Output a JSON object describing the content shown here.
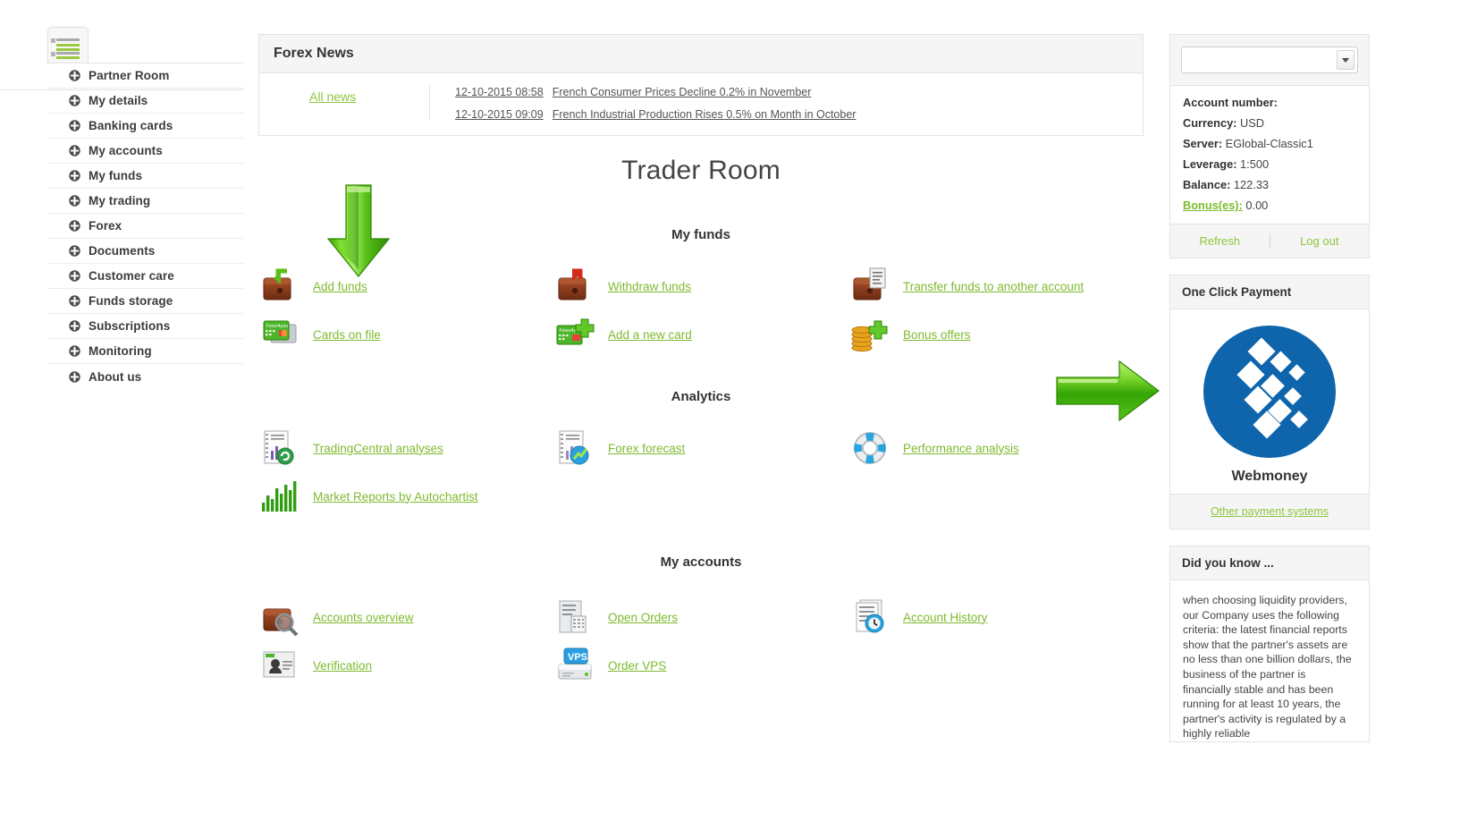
{
  "sidebar": {
    "toggle_icon": "list-menu-icon",
    "items": [
      {
        "label": "Partner Room",
        "icon": "plus-circle-icon"
      },
      {
        "label": "My details",
        "icon": "plus-circle-icon"
      },
      {
        "label": "Banking cards",
        "icon": "plus-circle-icon"
      },
      {
        "label": "My accounts",
        "icon": "plus-circle-icon"
      },
      {
        "label": "My funds",
        "icon": "plus-circle-icon"
      },
      {
        "label": "My trading",
        "icon": "plus-circle-icon"
      },
      {
        "label": "Forex",
        "icon": "plus-circle-icon"
      },
      {
        "label": "Documents",
        "icon": "plus-circle-icon"
      },
      {
        "label": "Customer care",
        "icon": "plus-circle-icon"
      },
      {
        "label": "Funds storage",
        "icon": "plus-circle-icon"
      },
      {
        "label": "Subscriptions",
        "icon": "plus-circle-icon"
      },
      {
        "label": "Monitoring",
        "icon": "plus-circle-icon"
      },
      {
        "label": "About us",
        "icon": "plus-circle-icon"
      }
    ]
  },
  "news": {
    "title": "Forex News",
    "all_news_label": "All news",
    "items": [
      {
        "date": "12-10-2015 08:58",
        "headline": "French Consumer Prices Decline 0.2% in November"
      },
      {
        "date": "12-10-2015 09:09",
        "headline": "French Industrial Production Rises 0.5% on Month in October"
      }
    ]
  },
  "main": {
    "page_title": "Trader Room",
    "sections": [
      {
        "title": "My funds",
        "rows": [
          [
            {
              "label": "Add funds",
              "icon": "wallet-in-icon"
            },
            {
              "label": "Withdraw funds",
              "icon": "wallet-out-icon"
            },
            {
              "label": "Transfer funds to another account",
              "icon": "wallet-transfer-icon"
            }
          ],
          [
            {
              "label": "Cards on file",
              "icon": "credit-cards-icon"
            },
            {
              "label": "Add a new card",
              "icon": "card-plus-icon"
            },
            {
              "label": "Bonus offers",
              "icon": "coins-plus-icon"
            }
          ]
        ]
      },
      {
        "title": "Analytics",
        "rows": [
          [
            {
              "label": "TradingCentral analyses",
              "icon": "report-refresh-icon"
            },
            {
              "label": "Forex forecast",
              "icon": "report-chart-icon"
            },
            {
              "label": "Performance analysis",
              "icon": "lifebuoy-icon"
            }
          ],
          [
            {
              "label": "Market Reports by Autochartist",
              "icon": "bar-chart-icon"
            },
            {
              "label": "",
              "icon": ""
            },
            {
              "label": "",
              "icon": ""
            }
          ]
        ]
      },
      {
        "title": "My accounts",
        "rows": [
          [
            {
              "label": "Accounts overview",
              "icon": "wallet-magnifier-icon"
            },
            {
              "label": "Open Orders",
              "icon": "server-list-icon"
            },
            {
              "label": "Account History",
              "icon": "documents-clock-icon"
            }
          ],
          [
            {
              "label": "Verification",
              "icon": "id-card-icon"
            },
            {
              "label": "Order VPS",
              "icon": "vps-server-icon"
            },
            {
              "label": "",
              "icon": ""
            }
          ]
        ]
      }
    ],
    "decor": {
      "down_arrow_icon": "green-down-arrow-icon",
      "right_arrow_icon": "green-right-arrow-icon"
    }
  },
  "account_panel": {
    "select_value": "",
    "select_caret_icon": "chevron-down-icon",
    "fields": [
      {
        "key": "Account number:",
        "value": ""
      },
      {
        "key": "Currency:",
        "value": "USD"
      },
      {
        "key": "Server:",
        "value": "EGlobal-Classic1"
      },
      {
        "key": "Leverage:",
        "value": "1:500"
      },
      {
        "key": "Balance:",
        "value": "122.33"
      },
      {
        "key": "Bonus(es):",
        "value": "0.00",
        "link": true
      }
    ],
    "refresh_label": "Refresh",
    "logout_label": "Log out"
  },
  "one_click_payment": {
    "title": "One Click Payment",
    "provider_name": "Webmoney",
    "provider_logo_icon": "webmoney-logo-icon",
    "other_systems_label": "Other payment systems"
  },
  "did_you_know": {
    "title": "Did you know ...",
    "text": "when choosing liquidity providers, our Company uses the following criteria: the latest financial reports show that the partner's assets are no less than one billion dollars, the business of the partner is financially stable and has been running for at least 10 years, the partner's activity is regulated by a highly reliable"
  },
  "colors": {
    "link_green": "#7dbb2e",
    "accent_green": "#8dc63f",
    "webmoney_blue": "#0e65ab",
    "panel_border": "#e3e3e3",
    "panel_head_bg": "#f5f5f5"
  }
}
